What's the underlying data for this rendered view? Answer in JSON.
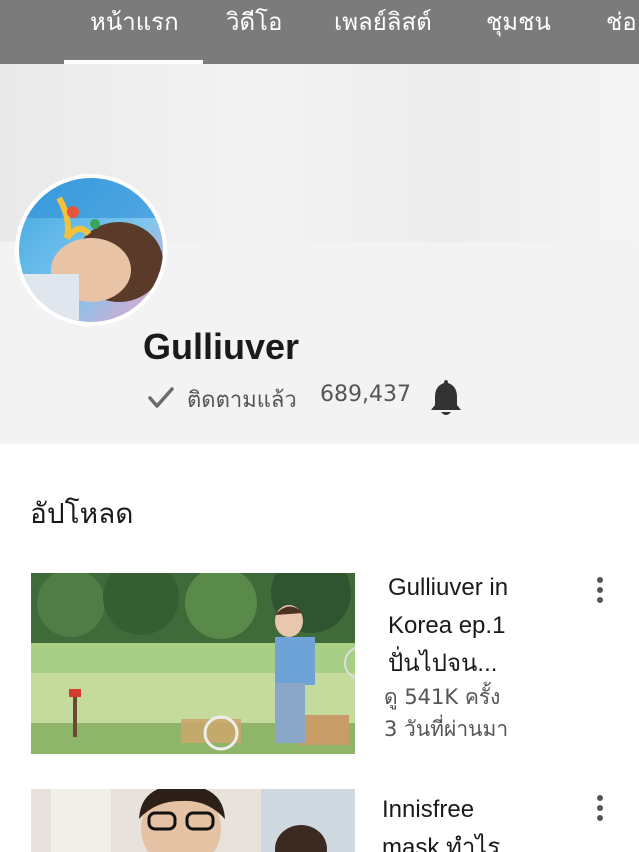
{
  "tabs": [
    {
      "label": "หน้าแรก",
      "active": true
    },
    {
      "label": "วิดีโอ",
      "active": false
    },
    {
      "label": "เพลย์ลิสต์",
      "active": false
    },
    {
      "label": "ชุมชน",
      "active": false
    },
    {
      "label": "ช่อ",
      "active": false
    }
  ],
  "channel": {
    "name": "Gulliuver",
    "subscribed_label": "ติดตามแล้ว",
    "subscriber_count": "689,437"
  },
  "section": {
    "title": "อัปโหลด"
  },
  "videos": [
    {
      "title_lines": [
        "Gulliuver in",
        "Korea ep.1",
        "ปั่นไปจน..."
      ],
      "views": "ดู 541K ครั้ง",
      "age": "3 วันที่ผ่านมา"
    },
    {
      "title_lines": [
        "Innisfree",
        "mask ทำไร"
      ],
      "views": "",
      "age": ""
    }
  ],
  "icons": {
    "subscribed": "check-icon",
    "notifications": "bell-icon",
    "more": "more-vert-icon"
  },
  "colors": {
    "tabbar": "#7b7b7b",
    "channel_bg": "#f3f3f3"
  }
}
